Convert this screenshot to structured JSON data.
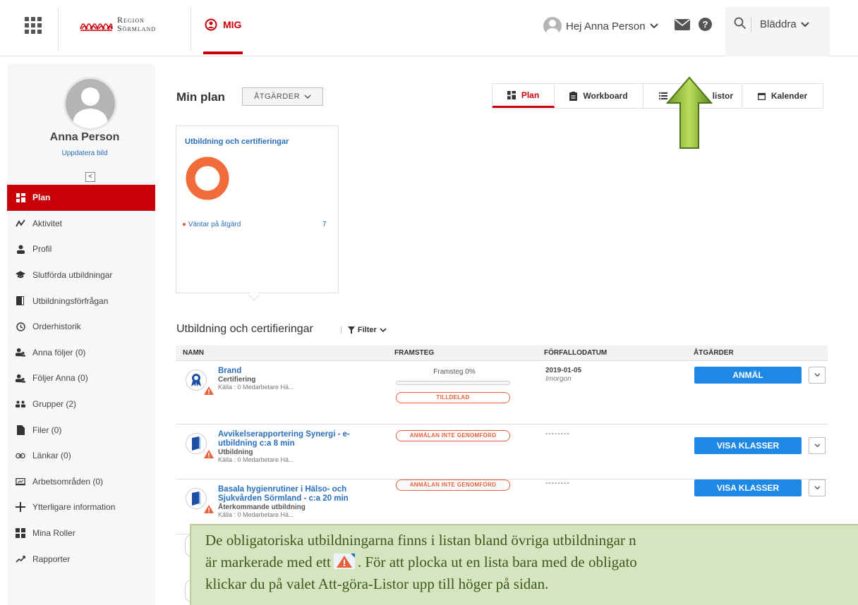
{
  "header": {
    "logo_line1": "Region",
    "logo_line2": "Sörmland",
    "mig_label": "MIG",
    "greeting": "Hej Anna Person",
    "browse_label": "Bläddra"
  },
  "sidebar": {
    "user_name": "Anna Person",
    "update_photo": "Uppdatera bild",
    "items": [
      {
        "label": "Plan",
        "icon": "plan-icon"
      },
      {
        "label": "Aktivitet",
        "icon": "activity-icon"
      },
      {
        "label": "Profil",
        "icon": "person-icon"
      },
      {
        "label": "Slutförda utbildningar",
        "icon": "graduation-cap-icon"
      },
      {
        "label": "Utbildningsförfrågan",
        "icon": "book-icon"
      },
      {
        "label": "Orderhistorik",
        "icon": "history-icon"
      },
      {
        "label": "Anna följer (0)",
        "icon": "users-icon"
      },
      {
        "label": "Följer Anna (0)",
        "icon": "users-icon"
      },
      {
        "label": "Grupper (2)",
        "icon": "group-icon"
      },
      {
        "label": "Filer (0)",
        "icon": "file-icon"
      },
      {
        "label": "Länkar (0)",
        "icon": "link-icon"
      },
      {
        "label": "Arbetsområden (0)",
        "icon": "workspace-icon"
      },
      {
        "label": "Ytterligare information",
        "icon": "plus-icon"
      },
      {
        "label": "Mina Roller",
        "icon": "roles-icon"
      },
      {
        "label": "Rapporter",
        "icon": "chart-line-icon"
      }
    ]
  },
  "main": {
    "plan_title": "Min plan",
    "actions_label": "ÅTGÄRDER",
    "tabs": [
      {
        "label": "Plan",
        "icon": "plan-icon"
      },
      {
        "label": "Workboard",
        "icon": "clipboard-icon"
      },
      {
        "label": "listor",
        "icon": "list-icon"
      },
      {
        "label": "Kalender",
        "icon": "calendar-icon"
      }
    ],
    "card": {
      "title": "Utbildning och certifieringar",
      "legend": "Väntar på åtgärd",
      "count": "7",
      "ring_color": "#f26b3a"
    },
    "section_title": "Utbildning och certifieringar",
    "filter_label": "Filter",
    "table": {
      "headers": [
        "NAMN",
        "FRAMSTEG",
        "FÖRFALLODATUM",
        "ÅTGÄRDER"
      ],
      "rows": [
        {
          "name": "Brand",
          "type": "Certifiering",
          "source": "Källa : 0 Medarbetare Hä...",
          "progress": "Framsteg 0%",
          "status": "TILLDELAD",
          "due": "2019-01-05",
          "due_sub": "Imorgon",
          "action": "ANMÄL"
        },
        {
          "name": "Avvikelserapportering Synergi - e-utbildning c:a 8 min",
          "type": "Utbildning",
          "source": "Källa : 0 Medarbetare Hä...",
          "status": "ANMÄLAN INTE GENOMFÖRD",
          "due": "--------",
          "action": "VISA KLASSER"
        },
        {
          "name": "Basala hygienrutiner i Hälso- och Sjukvården Sörmland - c:a 20 min",
          "type": "Återkommande utbildning",
          "source": "Källa : 0 Medarbetare Hä...",
          "status": "ANMÄLAN INTE GENOMFÖRD",
          "due": "--------",
          "action": "VISA KLASSER"
        }
      ]
    }
  },
  "callout": {
    "line1": "De obligatoriska utbildningarna finns i listan bland övriga utbildningar n",
    "line2a": "är markerade med ett",
    "line2b": ". För att plocka ut en lista bara med de obligato",
    "line3": "klickar du på valet Att-göra-Listor upp till höger på sidan."
  },
  "colors": {
    "brand_red": "#c8000a",
    "link_blue": "#2a6fbd",
    "button_blue": "#1e88e5",
    "pill_orange": "#e8603c",
    "callout_green": "#d6e4bf"
  }
}
